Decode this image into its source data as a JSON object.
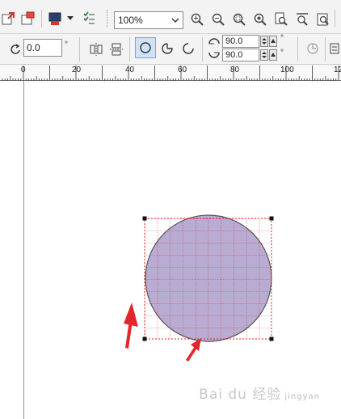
{
  "toolbar_top": {
    "zoom_value": "100%",
    "icons": [
      "import-icon",
      "export-icon",
      "publish-pdf-icon",
      "dropdown-arrow-icon",
      "options-icon",
      "zoom-in-icon",
      "zoom-out-icon",
      "zoom-selected-icon",
      "zoom-all-icon",
      "zoom-page-icon",
      "zoom-width-icon",
      "zoom-height-icon"
    ]
  },
  "property_bar": {
    "rotation_value": "0.0",
    "rotation_unit": "°",
    "start_angle_value": "90.0",
    "end_angle_value": "90.0",
    "angle_unit": "°",
    "ellipse_mode_selected": "ellipse"
  },
  "ruler": {
    "labels": [
      "0",
      "20",
      "40",
      "60",
      "80",
      "100",
      "12"
    ]
  },
  "canvas": {
    "shape": "ellipse",
    "fill_color": "#b9acd3",
    "outline_color": "#555555",
    "arrow_color": "#e3262b",
    "selection_color": "#e02020"
  },
  "watermark": {
    "text": "Bai du 经验",
    "sub": "jingyan"
  }
}
